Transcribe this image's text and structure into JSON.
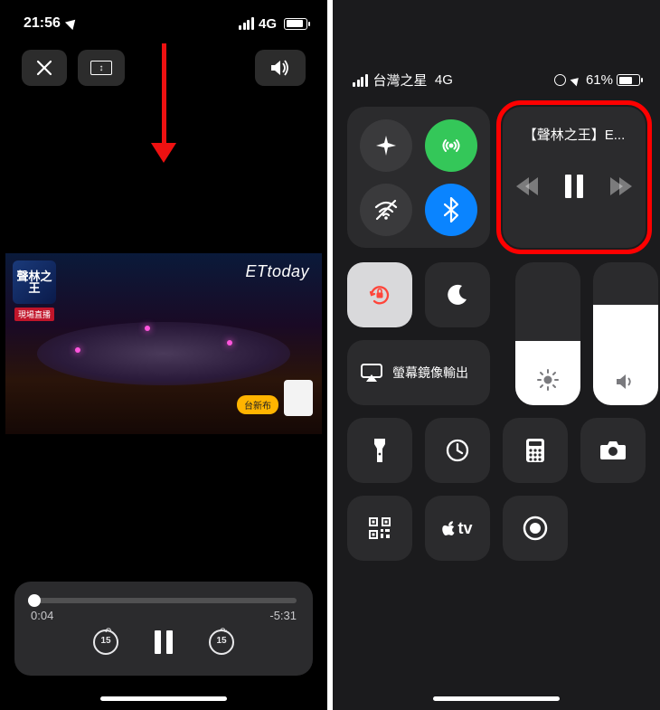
{
  "left": {
    "status": {
      "time": "21:56",
      "network": "4G",
      "battery_pct": 78
    },
    "controls": {
      "close_alt": "Close",
      "aspect_alt": "Fit",
      "sound_alt": "Volume"
    },
    "video": {
      "show_logo": "聲林之王",
      "watermark": "ETtoday",
      "red_tag": "現場直播",
      "cta_label": "台新布"
    },
    "player": {
      "elapsed": "0:04",
      "remaining": "-5:31",
      "progress_pct": 1.2,
      "skip_amount": "15"
    }
  },
  "right": {
    "status": {
      "carrier": "台灣之星",
      "network": "4G",
      "battery_pct": 61,
      "battery_label": "61%"
    },
    "connectivity": {
      "airplane": false,
      "cellular": true,
      "wifi": false,
      "bluetooth": true
    },
    "media": {
      "title": "【聲林之王】E...",
      "prev_alt": "Rewind",
      "play_alt": "Pause",
      "next_alt": "Fast-forward"
    },
    "toggles": {
      "orientation_lock": true,
      "dnd": false
    },
    "mirror_label": "螢幕鏡像輸出",
    "brightness_pct": 45,
    "volume_pct": 70,
    "utility": {
      "flashlight": "Flashlight",
      "timer": "Timer",
      "calculator": "Calculator",
      "camera": "Camera",
      "qr": "QR Scan",
      "appletv": "tv",
      "record": "Screen Record"
    }
  }
}
